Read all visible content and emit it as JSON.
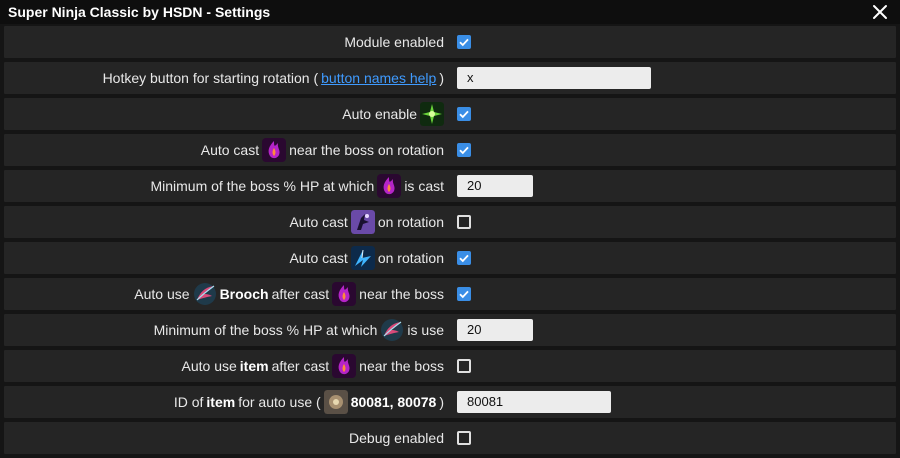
{
  "window": {
    "title": "Super Ninja Classic by HSDN - Settings"
  },
  "rows": [
    {
      "type": "checkbox",
      "checked": true,
      "label": "Module enabled"
    },
    {
      "type": "text",
      "label_pre": "Hotkey button for starting rotation (",
      "link": "button names help",
      "label_post": ")",
      "value": "x"
    },
    {
      "type": "checkbox",
      "checked": true,
      "label": "Auto enable"
    },
    {
      "type": "checkbox",
      "checked": true,
      "label_pre": "Auto cast",
      "label_post": "near the boss on rotation"
    },
    {
      "type": "text",
      "label_pre": "Minimum of the boss % HP at which",
      "label_post": "is cast",
      "value": "20"
    },
    {
      "type": "checkbox",
      "checked": false,
      "label_pre": "Auto cast",
      "label_post": "on rotation"
    },
    {
      "type": "checkbox",
      "checked": true,
      "label_pre": "Auto cast",
      "label_post": "on rotation"
    },
    {
      "type": "checkbox",
      "checked": true,
      "label_pre": "Auto use",
      "bold": "Brooch",
      "label_mid": "after cast",
      "label_post": "near the boss"
    },
    {
      "type": "text",
      "label_pre": "Minimum of the boss % HP at which",
      "label_post": "is use",
      "value": "20"
    },
    {
      "type": "checkbox",
      "checked": false,
      "label_pre": "Auto use",
      "bold": "item",
      "label_mid": "after cast",
      "label_post": "near the boss"
    },
    {
      "type": "text",
      "label_pre": "ID of",
      "bold": "item",
      "label_mid": "for auto use (",
      "bold2": "80081, 80078",
      "label_post": ")",
      "value": "80081"
    },
    {
      "type": "checkbox",
      "checked": false,
      "label": "Debug enabled"
    }
  ],
  "icons": {
    "close": "close-icon",
    "auto_enable": "green-star-skill-icon",
    "purple_flame": "purple-flame-skill-icon",
    "shadow_skill": "shadow-ninja-skill-icon",
    "blue_skill": "blue-lightning-skill-icon",
    "brooch": "feather-brooch-icon",
    "item": "item-box-icon"
  },
  "colors": {
    "accent": "#3a8ee6",
    "link": "#3f9bff",
    "row_bg": "#252525",
    "titlebar_bg": "#0e0e0e"
  }
}
